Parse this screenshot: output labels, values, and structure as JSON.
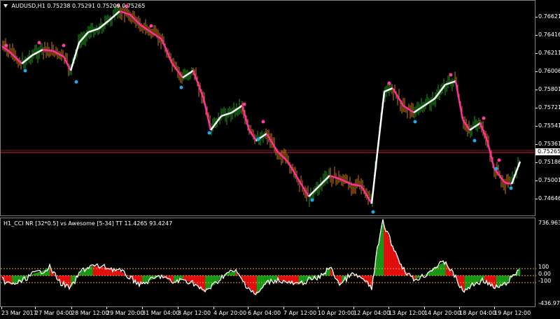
{
  "symbol_info": {
    "symbol": "AUDUSD,H1",
    "prices": "0.75238 0.75291 0.75209 0.75265"
  },
  "oscillator": {
    "title": "H1_CCI NR [32*0.5] vs Awesome [5-34] TT 11.4265 93.4247"
  },
  "price_axis": {
    "labels": [
      "0.76621",
      "0.76416",
      "0.76211",
      "0.76006",
      "0.75801",
      "0.75721",
      "0.75541",
      "0.75361",
      "0.75186",
      "0.75001",
      "0.74646"
    ],
    "current_price": "0.75265"
  },
  "osc_axis": {
    "labels": [
      "736.9638",
      "100",
      "0.00",
      "-100",
      "-436.9756"
    ]
  },
  "time_axis": {
    "labels": [
      "23 Mar 2017",
      "27 Mar 04:00",
      "28 Mar 12:00",
      "29 Mar 20:00",
      "31 Mar 04:00",
      "3 Apr 12:00",
      "4 Apr 20:00",
      "6 Apr 04:00",
      "7 Apr 12:00",
      "10 Apr 20:00",
      "12 Apr 04:00",
      "13 Apr 12:00",
      "14 Apr 20:00",
      "18 Apr 04:00",
      "19 Apr 12:00"
    ]
  },
  "colors": {
    "background": "#000000",
    "bull_bar": "#1ea01e",
    "bear_bar": "#d07a10",
    "trend_up": "#ffffff",
    "trend_down": "#ff2ea0",
    "marker_top": "#ff3aa0",
    "marker_bottom": "#20a8e8",
    "current_line": "#cc2244",
    "osc_green": "#18a018",
    "osc_red": "#ee1010",
    "level_line": "#e8a020"
  }
}
